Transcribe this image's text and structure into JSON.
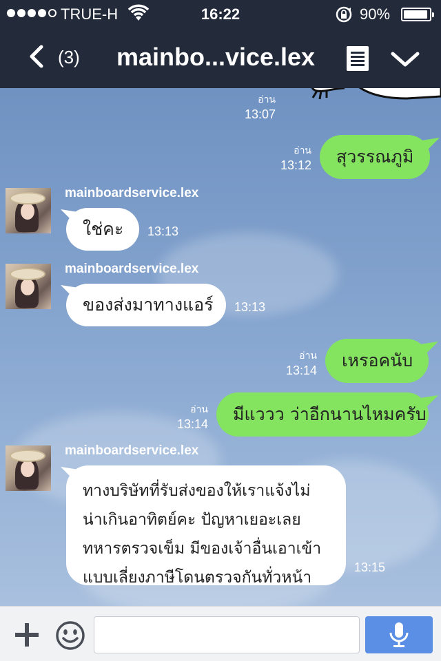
{
  "status_bar": {
    "carrier": "TRUE-H",
    "time": "16:22",
    "battery_percent": "90%",
    "signal_bars_filled": 4,
    "signal_bars_total": 5
  },
  "header": {
    "unread_count": "(3)",
    "title": "mainbo...vice.lex"
  },
  "messages": [
    {
      "direction": "out",
      "read_label": "อ่าน",
      "time": "13:07",
      "type": "sticker"
    },
    {
      "direction": "out",
      "text": "สุวรรณภูมิ",
      "read_label": "อ่าน",
      "time": "13:12"
    },
    {
      "direction": "in",
      "sender": "mainboardservice.lex",
      "text": "ใช่คะ",
      "time": "13:13"
    },
    {
      "direction": "in",
      "sender": "mainboardservice.lex",
      "text": "ของส่งมาทางแอร์",
      "time": "13:13"
    },
    {
      "direction": "out",
      "text": "เหรอคนับ",
      "read_label": "อ่าน",
      "time": "13:14"
    },
    {
      "direction": "out",
      "text": "มีแววว ว่าอีกนานไหมครับ",
      "read_label": "อ่าน",
      "time": "13:14"
    },
    {
      "direction": "in",
      "sender": "mainboardservice.lex",
      "lines": [
        "ทางบริษัทที่รับส่งของให้เราแจ้งไม่",
        "น่าเกินอาทิตย์คะ ปัญหาเยอะเลย",
        "ทหารตรวจเข็ม มีของเจ้าอื่นเอาเข้า",
        "แบบเลี่ยงภาษีโดนตรวจกันทั่วหน้า"
      ],
      "time": "13:15"
    }
  ],
  "input": {
    "value": "",
    "placeholder": ""
  },
  "colors": {
    "bar_bg": "#232a3a",
    "outgoing_bubble": "#84e35f",
    "incoming_bubble": "#ffffff",
    "mic_button": "#5b8fe6"
  },
  "icons": {
    "back": "chevron-left-icon",
    "notes": "notes-icon",
    "menu": "chevron-down-icon",
    "add": "plus-icon",
    "emoji": "smiley-icon",
    "mic": "microphone-icon",
    "wifi": "wifi-icon",
    "lock": "rotation-lock-icon"
  }
}
